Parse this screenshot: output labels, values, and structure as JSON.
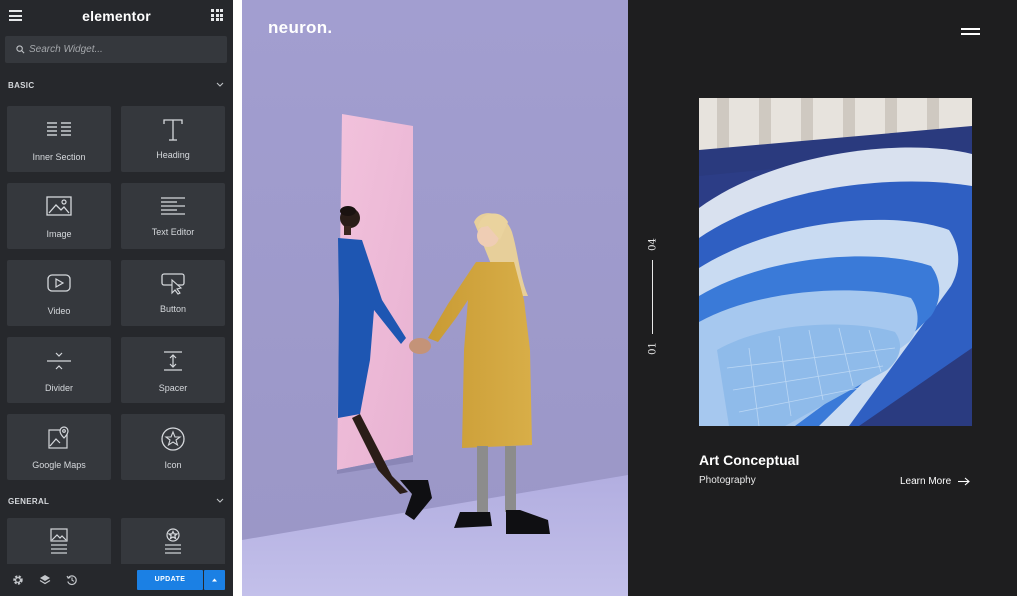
{
  "panel": {
    "brand": "elementor",
    "search_placeholder": "Search Widget...",
    "sections": [
      {
        "title": "BASIC"
      },
      {
        "title": "GENERAL"
      }
    ],
    "widgets": [
      {
        "label": "Inner Section",
        "icon": "inner-section-icon"
      },
      {
        "label": "Heading",
        "icon": "heading-icon"
      },
      {
        "label": "Image",
        "icon": "image-icon"
      },
      {
        "label": "Text Editor",
        "icon": "text-editor-icon"
      },
      {
        "label": "Video",
        "icon": "video-icon"
      },
      {
        "label": "Button",
        "icon": "button-icon"
      },
      {
        "label": "Divider",
        "icon": "divider-icon"
      },
      {
        "label": "Spacer",
        "icon": "spacer-icon"
      },
      {
        "label": "Google Maps",
        "icon": "google-maps-icon"
      },
      {
        "label": "Icon",
        "icon": "star-icon"
      }
    ],
    "general_widgets": [
      {
        "label": "",
        "icon": "image-box-icon"
      },
      {
        "label": "",
        "icon": "icon-box-icon"
      }
    ],
    "footer": {
      "update_label": "UPDATE",
      "icons": [
        "settings-icon",
        "navigator-icon",
        "history-icon"
      ]
    }
  },
  "preview": {
    "logo": "neuron.",
    "slider": {
      "start": "01",
      "end": "04"
    },
    "portfolio_item": {
      "title": "Art Conceptual",
      "category": "Photography",
      "link_label": "Learn More"
    }
  },
  "colors": {
    "panel_bg": "#26282c",
    "widget_bg": "#35383d",
    "update_blue": "#1b80e4",
    "hero_bg": "#a09ccc",
    "dark_bg": "#1e1e1f"
  }
}
